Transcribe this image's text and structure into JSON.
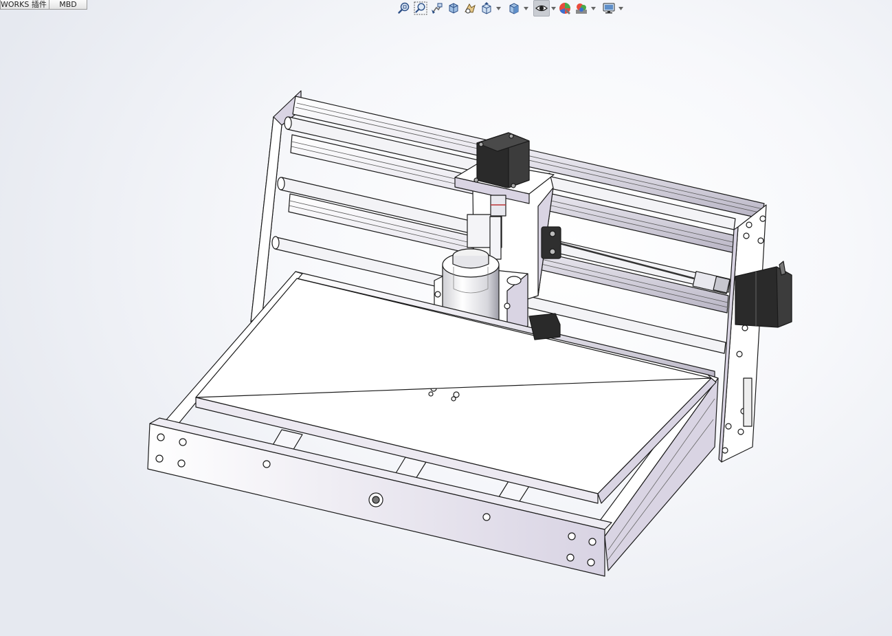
{
  "cmd_tabs": [
    {
      "label": "WORKS 插件"
    },
    {
      "label": "MBD"
    }
  ],
  "heads_up_toolbar": [
    {
      "icon": "zoom-to-fit-icon",
      "tooltip": ""
    },
    {
      "icon": "zoom-to-area-icon",
      "tooltip": ""
    },
    {
      "icon": "previous-view-icon",
      "tooltip": ""
    },
    {
      "icon": "section-view-icon",
      "tooltip": ""
    },
    {
      "icon": "dynamic-annotation-views-icon",
      "tooltip": ""
    },
    {
      "icon": "view-orientation-icon",
      "has_dropdown": true
    },
    {
      "icon": "display-style-icon",
      "has_dropdown": true
    },
    {
      "icon": "hide-show-items-icon",
      "has_dropdown": true,
      "active": true
    },
    {
      "icon": "edit-appearance-icon"
    },
    {
      "icon": "apply-scene-icon",
      "has_dropdown": true
    },
    {
      "icon": "view-settings-icon",
      "has_dropdown": true
    }
  ],
  "colors": {
    "background_center": "#ffffff",
    "background_edge": "#e6e9f0",
    "model_face": "#ffffff",
    "model_shade": "#d9d4e3",
    "model_edge": "#1a1a1a",
    "motor_body": "#2a2a2a"
  }
}
